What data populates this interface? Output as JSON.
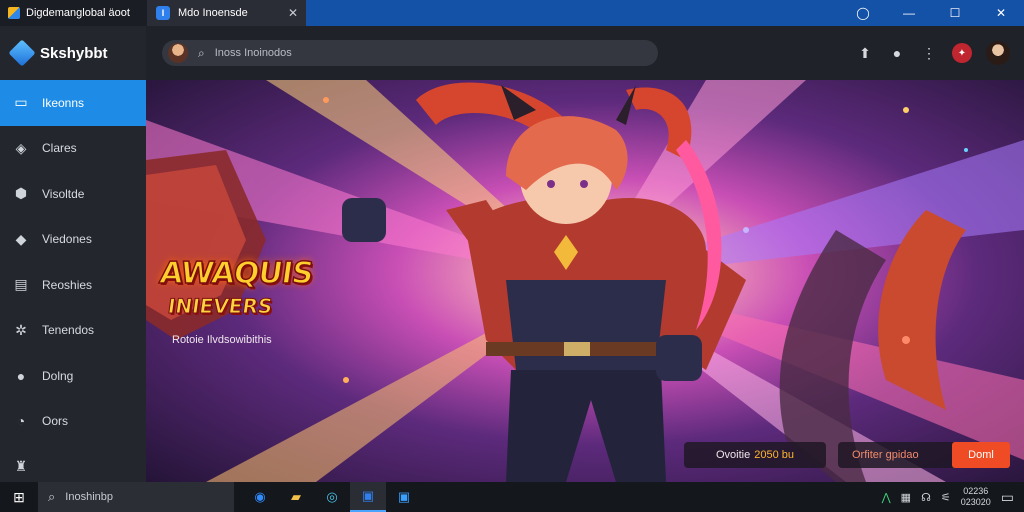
{
  "tabs": [
    {
      "title": "Digdemanglobal äoot",
      "icon": "launcher-icon"
    },
    {
      "title": "Mdo Inoensde",
      "icon": "page-icon",
      "close": "✕"
    }
  ],
  "window_controls": {
    "circle": "◯",
    "minimize": "—",
    "maximize": "☐",
    "close": "✕"
  },
  "app": {
    "name": "Skshybbt"
  },
  "sidebar": {
    "items": [
      {
        "label": "Ikeonns",
        "icon": "home-icon",
        "glyph": "▭",
        "active": true
      },
      {
        "label": "Clares",
        "icon": "games-icon",
        "glyph": "◈",
        "active": false
      },
      {
        "label": "Visoltde",
        "icon": "shield-icon",
        "glyph": "⬢",
        "active": false
      },
      {
        "label": "Viedones",
        "icon": "video-icon",
        "glyph": "◆",
        "active": false
      },
      {
        "label": "Reoshies",
        "icon": "window-icon",
        "glyph": "▤",
        "active": false
      },
      {
        "label": "Tenendos",
        "icon": "gear-icon",
        "glyph": "✲",
        "active": false
      },
      {
        "label": "Dolng",
        "icon": "location-icon",
        "glyph": "●",
        "active": false
      },
      {
        "label": "Oors",
        "icon": "clock-icon",
        "glyph": "◔",
        "active": false
      },
      {
        "label": "",
        "icon": "trophy-icon",
        "glyph": "♜",
        "active": false
      }
    ]
  },
  "search": {
    "placeholder": "Inoss Inoinodos",
    "icon": "search-icon"
  },
  "top_icons": [
    {
      "name": "upload-icon",
      "glyph": "⬆"
    },
    {
      "name": "chat-icon",
      "glyph": "●"
    },
    {
      "name": "more-icon",
      "glyph": "⋮"
    }
  ],
  "hero": {
    "logo_line1": "AWAQUIS",
    "logo_line2": "INIEVERS",
    "tagline": "Rotoie Ilvdsowibithis",
    "promo_label": "Ovoitie",
    "promo_value": "2050 bu",
    "cta_label": "Orfiter gpidao",
    "cta_button": "Doml"
  },
  "taskbar": {
    "start_icon": "windows-start-icon",
    "search_text": "Inoshinbp",
    "apps": [
      {
        "name": "edge-icon",
        "glyph": "◉",
        "color": "#2f8cff"
      },
      {
        "name": "folder-icon",
        "glyph": "▰",
        "color": "#f2c14a"
      },
      {
        "name": "media-icon",
        "glyph": "◎",
        "color": "#4cc6e8"
      },
      {
        "name": "app-icon",
        "glyph": "▣",
        "color": "#2f80ed"
      },
      {
        "name": "store-icon",
        "glyph": "▣",
        "color": "#3aa0ff"
      }
    ],
    "tray_items": [
      "⋀",
      "▦",
      "☊",
      "⚟"
    ],
    "clock_time": "02236",
    "clock_date": "023020",
    "notify_icon": "▭"
  },
  "colors": {
    "accent": "#1e8ce6",
    "titlebar": "#1452a8",
    "cta": "#ef4b24"
  }
}
